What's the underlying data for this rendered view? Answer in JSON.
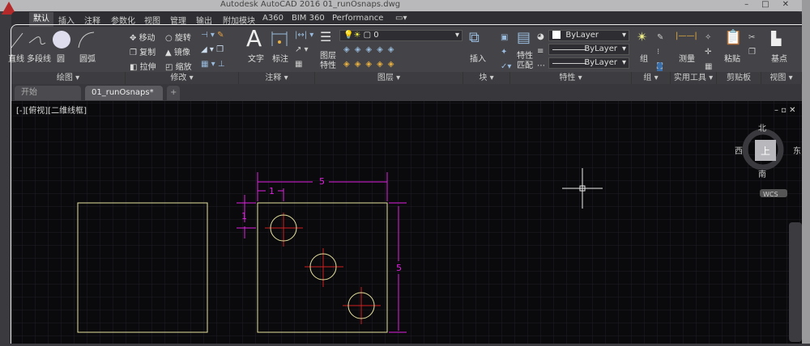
{
  "title": "Autodesk AutoCAD 2016    01_runOsnaps.dwg",
  "menu_tabs": [
    "默认",
    "插入",
    "注释",
    "参数化",
    "视图",
    "管理",
    "输出",
    "附加模块",
    "A360",
    "BIM 360",
    "Performance"
  ],
  "ribbon": {
    "draw": {
      "label": "绘图",
      "line": "直线",
      "polyline": "多段线",
      "circle": "圆",
      "arc": "圆弧"
    },
    "modify": {
      "label": "修改",
      "move": "移动",
      "rotate": "旋转",
      "copy": "复制",
      "mirror": "镜像",
      "stretch": "拉伸",
      "scale": "缩放"
    },
    "annotation": {
      "label": "注释",
      "text": "文字",
      "dimension": "标注"
    },
    "layers": {
      "label": "图层",
      "properties": "图层\n特性",
      "current_layer": "0"
    },
    "block": {
      "label": "块",
      "insert": "插入"
    },
    "properties": {
      "label": "特性",
      "match": "特性\n匹配",
      "color": "ByLayer",
      "linetype": "ByLayer",
      "lineweight": "ByLayer"
    },
    "groups": {
      "label": "组",
      "group": "组"
    },
    "utilities": {
      "label": "实用工具",
      "measure": "测量"
    },
    "clipboard": {
      "label": "剪贴板",
      "paste": "粘贴"
    },
    "view": {
      "label": "视图",
      "base": "基点"
    }
  },
  "file_tabs": [
    "开始",
    "01_runOsnaps*"
  ],
  "viewport_label": "[-][俯视][二维线框]",
  "viewcube": {
    "north": "北",
    "south": "南",
    "east": "东",
    "west": "西",
    "top": "上",
    "ucs": "WCS"
  },
  "dimensions": {
    "width": "5",
    "height": "5",
    "offset_x": "1",
    "offset_y": "1"
  },
  "colors": {
    "geometry": "#e8e2a0",
    "dimension": "#e020e0",
    "centerline": "#d02020",
    "background": "#0a0a0c"
  }
}
